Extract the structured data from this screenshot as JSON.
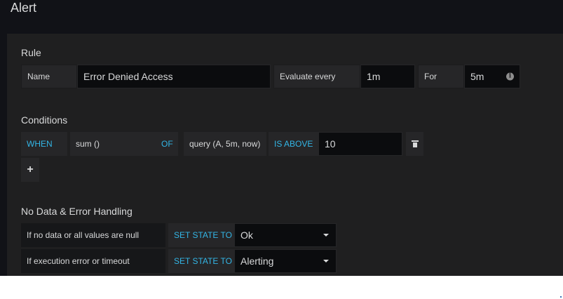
{
  "header": {
    "title": "Alert"
  },
  "rule": {
    "section_title": "Rule",
    "name_label": "Name",
    "name_value": "Error Denied Access",
    "evaluate_label": "Evaluate every",
    "evaluate_value": "1m",
    "for_label": "For",
    "for_value": "5m",
    "info_icon": "info-icon"
  },
  "conditions": {
    "section_title": "Conditions",
    "when": "WHEN",
    "reducer": "sum ()",
    "of": "OF",
    "query": "query (A, 5m, now)",
    "evaluator": "IS ABOVE",
    "threshold": "10",
    "add_label": "+"
  },
  "no_data": {
    "section_title": "No Data & Error Handling",
    "rows": [
      {
        "label": "If no data or all values are null",
        "set_state": "SET STATE TO",
        "value": "Ok"
      },
      {
        "label": "If execution error or timeout",
        "set_state": "SET STATE TO",
        "value": "Alerting"
      }
    ]
  },
  "colors": {
    "background": "#111217",
    "panel": "#1f1f20",
    "keyword": "#33b5e5",
    "text": "#d8d9da"
  }
}
